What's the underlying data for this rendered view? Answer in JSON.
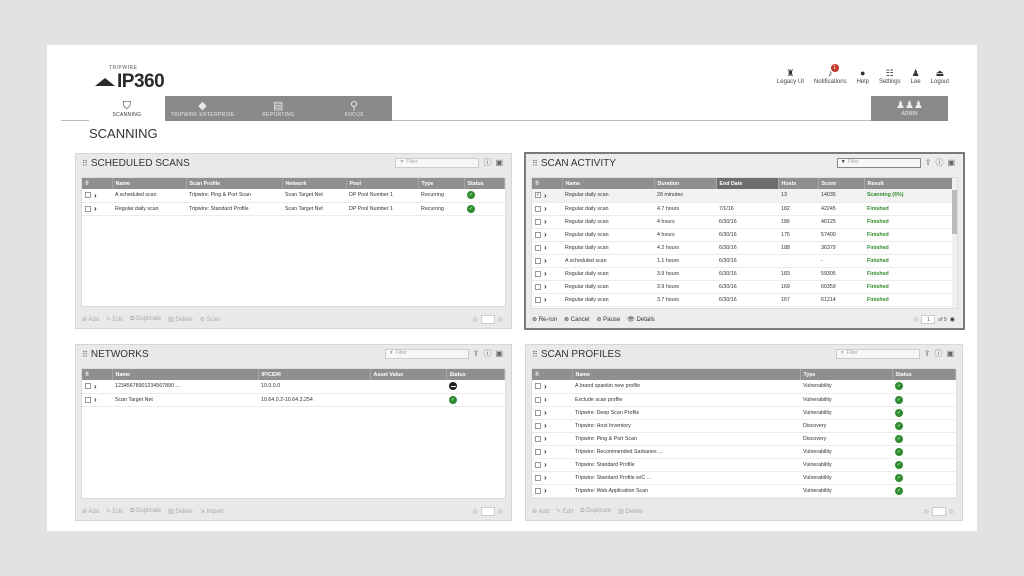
{
  "brand": {
    "top": "TRIPWIRE",
    "name": "IP360"
  },
  "top_nav": [
    {
      "label": "Legacy UI",
      "icon": "lamp-icon"
    },
    {
      "label": "Notifications",
      "icon": "bell-icon",
      "badge": "1"
    },
    {
      "label": "Help",
      "icon": "help-icon"
    },
    {
      "label": "Settings",
      "icon": "settings-icon"
    },
    {
      "label": "Lee",
      "icon": "user-icon"
    },
    {
      "label": "Logout",
      "icon": "logout-icon"
    }
  ],
  "tabs": [
    {
      "label": "SCANNING",
      "icon": "shield-icon",
      "active": true
    },
    {
      "label": "TRIPWIRE ENTERPRISE",
      "icon": "cube-icon"
    },
    {
      "label": "REPORTING",
      "icon": "report-icon"
    },
    {
      "label": "FOCUS",
      "icon": "magnifier-icon"
    }
  ],
  "admin": {
    "label": "ADMIN"
  },
  "page_title": "SCANNING",
  "filter_placeholder": "Filter",
  "scheduled": {
    "title": "SCHEDULED SCANS",
    "headers": [
      "Name",
      "Scan Profile",
      "Network",
      "Pool",
      "Type",
      "Status"
    ],
    "rows": [
      [
        "A scheduled scan",
        "Tripwire: Ping & Port Scan",
        "Scan Target Net",
        "DP Pool Number 1",
        "Recurring"
      ],
      [
        "Regular daily scan",
        "Tripwire: Standard Profile",
        "Scan Target Net",
        "DP Pool Number 1",
        "Recurring"
      ]
    ],
    "actions": [
      "Add",
      "Edit",
      "Duplicate",
      "Delete",
      "Scan"
    ]
  },
  "activity": {
    "title": "SCAN ACTIVITY",
    "headers": [
      "Name",
      "Duration",
      "End Date",
      "Hosts",
      "Score",
      "Result"
    ],
    "rows": [
      [
        "Regular daily scan",
        "28 minutes",
        "",
        "13",
        "14035",
        "Scanning (6%)"
      ],
      [
        "Regular daily scan",
        "4.7 hours",
        "7/1/16",
        "182",
        "42245",
        "Finished"
      ],
      [
        "Regular daily scan",
        "4 hours",
        "6/30/16",
        "186",
        "46125",
        "Finished"
      ],
      [
        "Regular daily scan",
        "4 hours",
        "6/30/16",
        "175",
        "57400",
        "Finished"
      ],
      [
        "Regular daily scan",
        "4.2 hours",
        "6/30/16",
        "188",
        "36379",
        "Finished"
      ],
      [
        "A scheduled scan",
        "1.1 hours",
        "6/30/16",
        "",
        "-",
        "Finished"
      ],
      [
        "Regular daily scan",
        "3.9 hours",
        "6/30/16",
        "183",
        "59305",
        "Finished"
      ],
      [
        "Regular daily scan",
        "3.9 hours",
        "6/30/16",
        "169",
        "60359",
        "Finished"
      ],
      [
        "Regular daily scan",
        "3.7 hours",
        "6/30/16",
        "167",
        "61214",
        "Finished"
      ]
    ],
    "actions": [
      "Re-run",
      "Cancel",
      "Pause",
      "Details"
    ],
    "page": "1",
    "page_of": "of 5"
  },
  "networks": {
    "title": "NETWORKS",
    "headers": [
      "Name",
      "IP/CIDR",
      "Asset Value",
      "Status"
    ],
    "rows": [
      [
        "12345678901234567890 ...",
        "10.0.0.0",
        "",
        "none"
      ],
      [
        "Scan Target Net",
        "10.64.0.2-10.64.3.254",
        "",
        "ok"
      ]
    ],
    "actions": [
      "Add",
      "Edit",
      "Duplicate",
      "Delete",
      "Import"
    ]
  },
  "profiles": {
    "title": "SCAN PROFILES",
    "headers": [
      "Name",
      "Type",
      "Status"
    ],
    "rows": [
      [
        "A brand spankin new profile",
        "Vulnerability"
      ],
      [
        "Exclude scan profile",
        "Vulnerability"
      ],
      [
        "Tripwire: Deep Scan Profile",
        "Vulnerability"
      ],
      [
        "Tripwire: Host Inventory",
        "Discovery"
      ],
      [
        "Tripwire: Ping & Port Scan",
        "Discovery"
      ],
      [
        "Tripwire: Recommended Sarbanes ...",
        "Vulnerability"
      ],
      [
        "Tripwire: Standard Profile",
        "Vulnerability"
      ],
      [
        "Tripwire: Standard Profile w/C ...",
        "Vulnerability"
      ],
      [
        "Tripwire: Web Application Scan",
        "Vulnerability"
      ]
    ],
    "actions": [
      "Add",
      "Edit",
      "Duplicate",
      "Delete"
    ]
  }
}
